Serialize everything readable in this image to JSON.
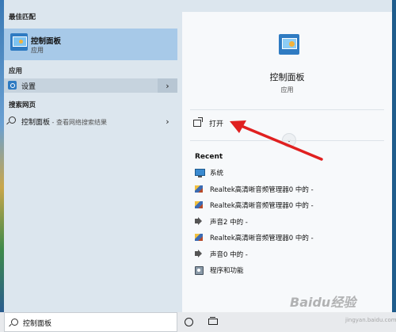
{
  "left_pane": {
    "best_match_heading": "最佳匹配",
    "best_match": {
      "name": "控制面板",
      "type": "应用"
    },
    "apps_heading": "应用",
    "apps": [
      {
        "label": "设置"
      }
    ],
    "web_heading": "搜索网页",
    "web_results": [
      {
        "label": "控制面板",
        "sub": " - 查看网络搜索结果"
      }
    ]
  },
  "right_pane": {
    "app_name": "控制面板",
    "app_type": "应用",
    "open_label": "打开",
    "recent_heading": "Recent",
    "recent_items": [
      {
        "icon": "monitor-icon",
        "label": "系统"
      },
      {
        "icon": "realtek-icon",
        "label": "Realtek高清晰音频管理器0 中的 -"
      },
      {
        "icon": "realtek-icon",
        "label": "Realtek高清晰音频管理器0 中的 -"
      },
      {
        "icon": "speaker-icon",
        "label": "声音2 中的 -"
      },
      {
        "icon": "realtek-icon",
        "label": "Realtek高清晰音频管理器0 中的 -"
      },
      {
        "icon": "speaker-icon",
        "label": "声音0 中的 -"
      },
      {
        "icon": "programs-icon",
        "label": "程序和功能"
      }
    ]
  },
  "taskbar": {
    "search_value": "控制面板"
  },
  "watermark": {
    "text": "Baidu经验",
    "sub": "jingyan.baidu.com"
  },
  "colors": {
    "accent": "#2f7bc2",
    "highlight": "#a7c9e8",
    "arrow": "#e02020"
  }
}
